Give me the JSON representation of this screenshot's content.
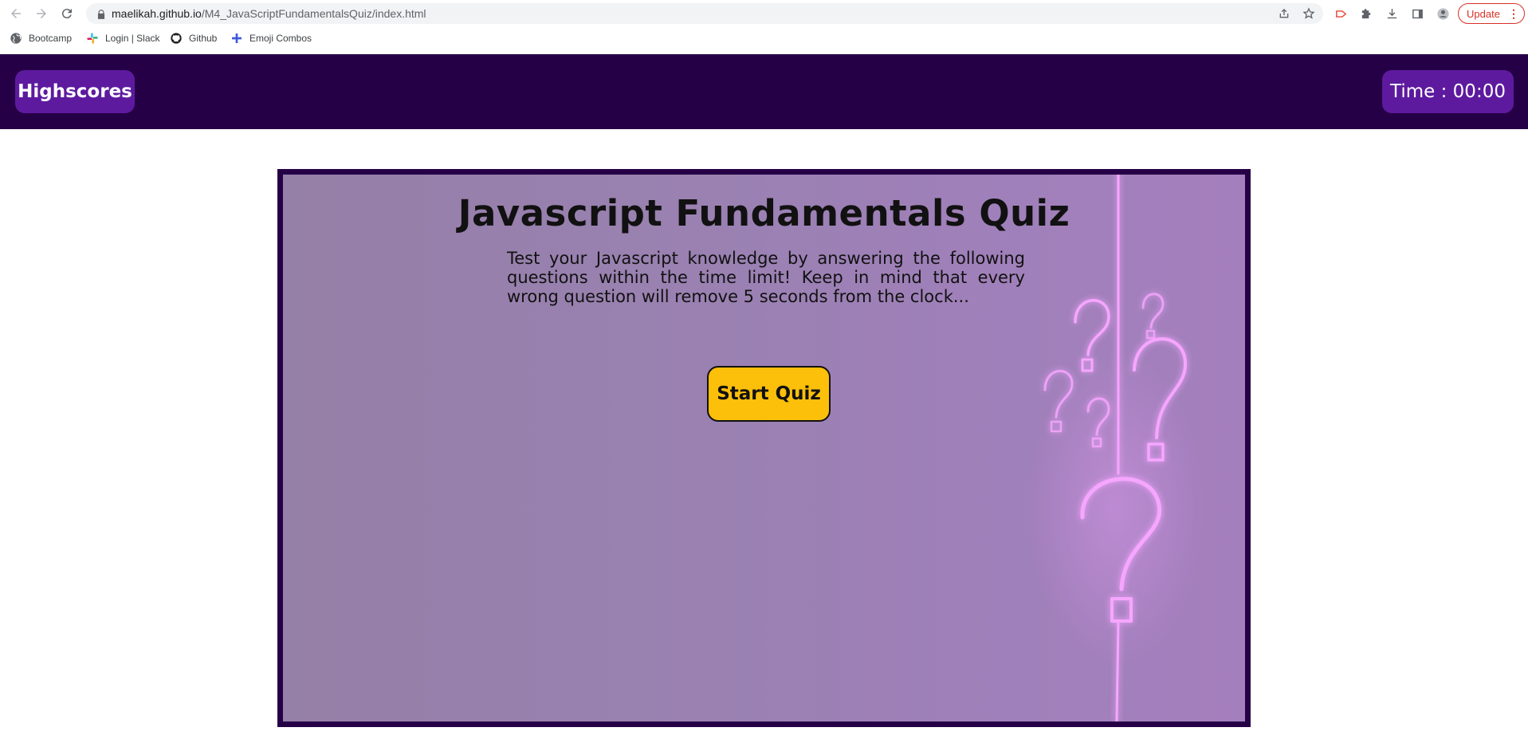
{
  "browser": {
    "url_host": "maelikah.github.io",
    "url_path": "/M4_JavaScriptFundamentalsQuiz/index.html",
    "update_label": "Update",
    "bookmarks": [
      {
        "label": "Bootcamp",
        "icon": "globe-icon"
      },
      {
        "label": "Login | Slack",
        "icon": "slack-icon"
      },
      {
        "label": "Github",
        "icon": "github-icon"
      },
      {
        "label": "Emoji Combos",
        "icon": "plus-icon"
      }
    ]
  },
  "header": {
    "highscores_label": "Highscores",
    "timer_label": "Time : 00:00"
  },
  "quiz": {
    "title": "Javascript Fundamentals Quiz",
    "description": "Test your Javascript knowledge by answering the following questions within the time limit! Keep in mind that every wrong question will remove 5 seconds from the clock...",
    "start_label": "Start Quiz"
  },
  "colors": {
    "header_bg": "#260047",
    "header_button": "#5d1a9f",
    "start_button": "#fcbf0a",
    "neon": "#f6a6ff"
  }
}
